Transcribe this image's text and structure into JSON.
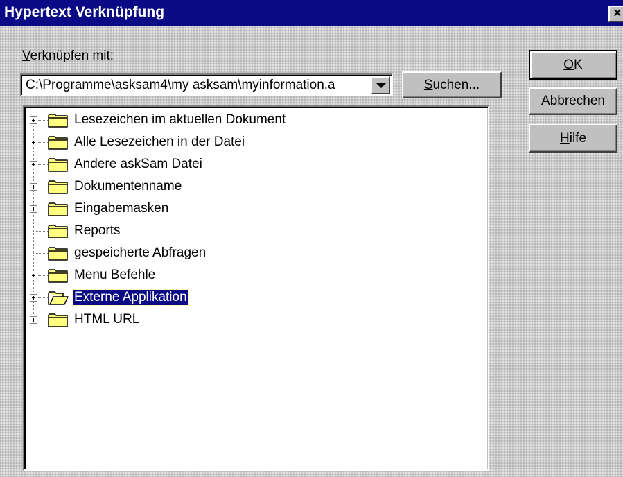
{
  "dialog": {
    "title": "Hypertext Verknüpfung",
    "close_label": "×"
  },
  "link": {
    "label_accel": "V",
    "label_rest": "erknüpfen mit:",
    "value": "C:\\Programme\\asksam4\\my asksam\\myinformation.a"
  },
  "buttons": {
    "search_accel": "S",
    "search_rest": "uchen...",
    "ok_accel": "O",
    "ok_rest": "K",
    "cancel_label": "Abbrechen",
    "help_accel": "H",
    "help_rest": "ilfe"
  },
  "tree": {
    "items": [
      {
        "label": "Lesezeichen im aktuellen Dokument",
        "expandable": true,
        "open": false,
        "selected": false
      },
      {
        "label": "Alle Lesezeichen in der Datei",
        "expandable": true,
        "open": false,
        "selected": false
      },
      {
        "label": "Andere askSam Datei",
        "expandable": true,
        "open": false,
        "selected": false
      },
      {
        "label": "Dokumentenname",
        "expandable": true,
        "open": false,
        "selected": false
      },
      {
        "label": "Eingabemasken",
        "expandable": true,
        "open": false,
        "selected": false
      },
      {
        "label": "Reports",
        "expandable": false,
        "open": false,
        "selected": false
      },
      {
        "label": "gespeicherte Abfragen",
        "expandable": false,
        "open": false,
        "selected": false
      },
      {
        "label": "Menu Befehle",
        "expandable": true,
        "open": false,
        "selected": false
      },
      {
        "label": "Externe Applikation",
        "expandable": true,
        "open": true,
        "selected": true
      },
      {
        "label": "HTML URL",
        "expandable": true,
        "open": false,
        "selected": false
      }
    ]
  },
  "colors": {
    "titlebar": "#0a0a86",
    "selection": "#0a0a86",
    "folder_fill": "#ffff80",
    "dialog_face": "#c0c0c0"
  },
  "icons": {
    "closed_folder": "folder-icon",
    "open_folder": "open-folder-icon",
    "expand": "plus-box-icon"
  }
}
